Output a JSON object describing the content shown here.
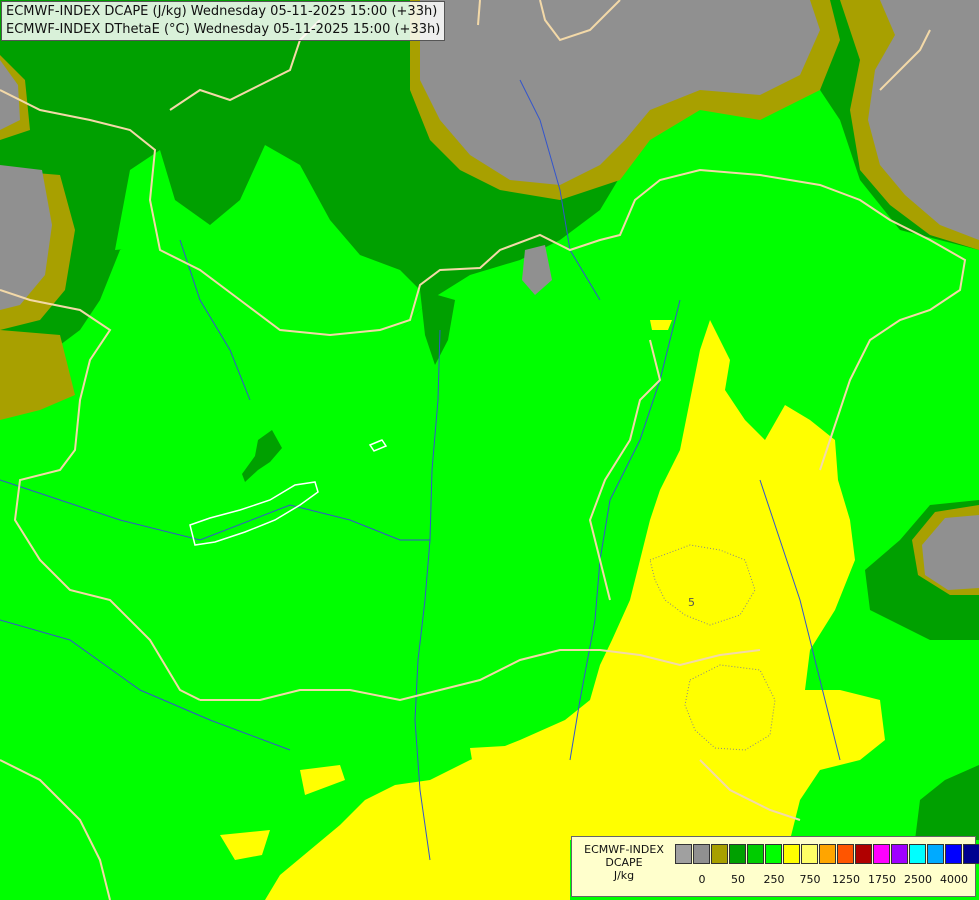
{
  "header": {
    "line1": "ECMWF-INDEX DCAPE (J/kg) Wednesday 05-11-2025 15:00 (+33h)",
    "line2": "ECMWF-INDEX DThetaE (°C) Wednesday 05-11-2025 15:00 (+33h)"
  },
  "map": {
    "contour_label": "5",
    "colors": {
      "gray": "#909090",
      "olive": "#a8a000",
      "dark_green": "#00a000",
      "green": "#00ff00",
      "yellow": "#ffff00",
      "border": "#f3d9a8",
      "river": "#3355cc"
    }
  },
  "legend": {
    "line1": "ECMWF-INDEX",
    "line2": "DCAPE",
    "line3": "J/kg",
    "colors": [
      "#a0a0a0",
      "#909090",
      "#a8a000",
      "#00a000",
      "#00cc00",
      "#00ff00",
      "#ffff00",
      "#ffff66",
      "#ffa500",
      "#ff5500",
      "#b00000",
      "#ff00ff",
      "#a000ff",
      "#00ffff",
      "#00aaff",
      "#0000ff",
      "#000090"
    ],
    "ticks": [
      "0",
      "50",
      "250",
      "750",
      "1250",
      "1750",
      "2500",
      "4000"
    ]
  }
}
